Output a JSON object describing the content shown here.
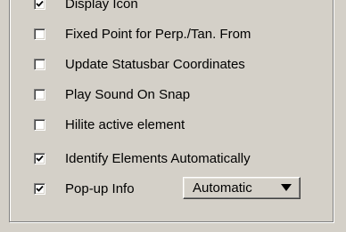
{
  "options": [
    {
      "label": "Display Icon",
      "checked": true
    },
    {
      "label": "Fixed Point for Perp./Tan. From",
      "checked": false
    },
    {
      "label": "Update Statusbar Coordinates",
      "checked": false
    },
    {
      "label": "Play Sound On Snap",
      "checked": false
    },
    {
      "label": "Hilite active element",
      "checked": false
    },
    {
      "label": "Identify Elements Automatically",
      "checked": true
    },
    {
      "label": "Pop-up Info",
      "checked": true
    }
  ],
  "popup_info_select": {
    "selected": "Automatic",
    "icon": "triangle-down-icon"
  }
}
